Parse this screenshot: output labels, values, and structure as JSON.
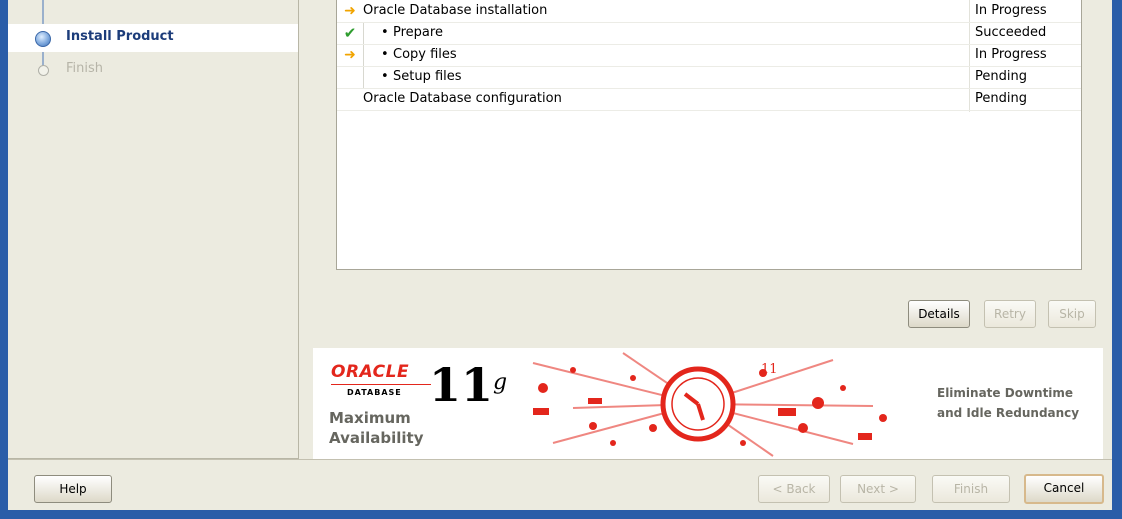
{
  "navigation": {
    "steps": [
      {
        "label": "Install Product",
        "state": "current"
      },
      {
        "label": "Finish",
        "state": "pending"
      }
    ]
  },
  "progress": {
    "rows": [
      {
        "icon": "arrow-right-icon",
        "name": "Oracle Database installation",
        "status": "In Progress",
        "indent": 0
      },
      {
        "icon": "checkmark-icon",
        "name": "Prepare",
        "status": "Succeeded",
        "indent": 1
      },
      {
        "icon": "arrow-right-icon",
        "name": "Copy files",
        "status": "In Progress",
        "indent": 1
      },
      {
        "icon": "",
        "name": "Setup files",
        "status": "Pending",
        "indent": 1
      },
      {
        "icon": "",
        "name": "Oracle Database configuration",
        "status": "Pending",
        "indent": 0
      }
    ]
  },
  "actions": {
    "details": "Details",
    "retry": "Retry",
    "skip": "Skip"
  },
  "banner": {
    "brand": "ORACLE",
    "product": "DATABASE",
    "version": "11",
    "version_suffix": "g",
    "subtitle_line1": "Maximum",
    "subtitle_line2": "Availability",
    "tagline_line1": "Eliminate Downtime",
    "tagline_line2": "and Idle Redundancy",
    "accent_color": "#e3261c"
  },
  "footer": {
    "help": "Help",
    "back": "< Back",
    "next": "Next >",
    "finish": "Finish",
    "cancel": "Cancel"
  }
}
